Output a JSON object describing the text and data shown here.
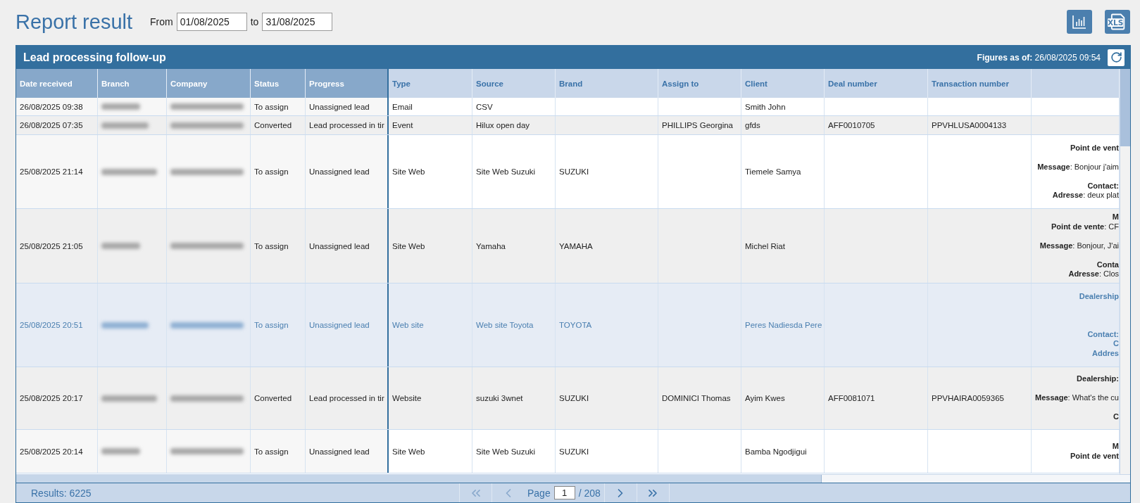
{
  "page_title": "Report result",
  "date_range": {
    "from_label": "From",
    "from_value": "01/08/2025",
    "to_label": "to",
    "to_value": "31/08/2025"
  },
  "toolbar_buttons": [
    {
      "kind": "chart"
    },
    {
      "kind": "xls",
      "label": "XLS"
    }
  ],
  "panel": {
    "title": "Lead processing follow-up",
    "figures_as_of": "**Figures as of:** 26/08/2025 09:54"
  },
  "table": {
    "columns": [
      {
        "label": "Date received",
        "frozen": true
      },
      {
        "label": "Branch",
        "frozen": true
      },
      {
        "label": "Company",
        "frozen": true
      },
      {
        "label": "Status",
        "frozen": true
      },
      {
        "label": "Progress",
        "frozen": true
      },
      {
        "label": "Type",
        "frozen": false
      },
      {
        "label": "Source",
        "frozen": false
      },
      {
        "label": "Brand",
        "frozen": false
      },
      {
        "label": "Assign to",
        "frozen": false
      },
      {
        "label": "Client",
        "frozen": false
      },
      {
        "label": "Deal number",
        "frozen": false
      },
      {
        "label": "Transaction number",
        "frozen": false
      },
      {
        "frozen": false
      }
    ],
    "rows": [
      {
        "selected": false,
        "cells": [
          {
            "kind": "text",
            "text": "26/08/2025 09:38"
          },
          {
            "kind": "blurred"
          },
          {
            "kind": "blurred"
          },
          {
            "kind": "text",
            "text": "To assign"
          },
          {
            "kind": "text",
            "text": "Unassigned lead"
          },
          {
            "kind": "text",
            "text": "Email"
          },
          {
            "kind": "text",
            "text": "CSV"
          },
          {
            "kind": "empty"
          },
          {
            "kind": "empty"
          },
          {
            "kind": "text",
            "text": "Smith John"
          },
          {
            "kind": "empty"
          },
          {
            "kind": "empty"
          },
          {
            "kind": "empty"
          }
        ]
      },
      {
        "selected": false,
        "cells": [
          {
            "kind": "text",
            "text": "26/08/2025 07:35"
          },
          {
            "kind": "blurred"
          },
          {
            "kind": "blurred"
          },
          {
            "kind": "text",
            "text": "Converted"
          },
          {
            "kind": "text",
            "text": "Lead processed in tir"
          },
          {
            "kind": "text",
            "text": "Event"
          },
          {
            "kind": "text",
            "text": "Hilux open day"
          },
          {
            "kind": "empty"
          },
          {
            "kind": "text",
            "text": "PHILLIPS Georgina"
          },
          {
            "kind": "text",
            "text": "gfds"
          },
          {
            "kind": "text",
            "text": "AFF0010705"
          },
          {
            "kind": "text",
            "text": "PPVHLUSA0004133"
          },
          {
            "kind": "empty"
          }
        ]
      },
      {
        "selected": false,
        "cells": [
          {
            "kind": "text",
            "text": "25/08/2025 21:14"
          },
          {
            "kind": "blurred"
          },
          {
            "kind": "blurred"
          },
          {
            "kind": "text",
            "text": "To assign"
          },
          {
            "kind": "text",
            "text": "Unassigned lead"
          },
          {
            "kind": "text",
            "text": "Site Web"
          },
          {
            "kind": "text",
            "text": "Site Web Suzuki"
          },
          {
            "kind": "text",
            "text": "SUZUKI"
          },
          {
            "kind": "empty"
          },
          {
            "kind": "text",
            "text": "Tiemele Samya"
          },
          {
            "kind": "empty"
          },
          {
            "kind": "empty"
          },
          {
            "kind": "notes",
            "lines": [
              {
                "kind": "line",
                "text": "Point de vent",
                "bold": true
              },
              {
                "kind": "blank"
              },
              {
                "kind": "line",
                "text": "**Message**: Bonjour j'aim",
                "bold": false
              },
              {
                "kind": "blank"
              },
              {
                "kind": "line",
                "text": "Contact:",
                "bold": true
              },
              {
                "kind": "line",
                "text": "**Adresse**: deux plat",
                "bold": false
              }
            ]
          }
        ]
      },
      {
        "selected": false,
        "cells": [
          {
            "kind": "text",
            "text": "25/08/2025 21:05"
          },
          {
            "kind": "blurred"
          },
          {
            "kind": "blurred"
          },
          {
            "kind": "text",
            "text": "To assign"
          },
          {
            "kind": "text",
            "text": "Unassigned lead"
          },
          {
            "kind": "text",
            "text": "Site Web"
          },
          {
            "kind": "text",
            "text": "Yamaha"
          },
          {
            "kind": "text",
            "text": "YAMAHA"
          },
          {
            "kind": "empty"
          },
          {
            "kind": "text",
            "text": "Michel Riat"
          },
          {
            "kind": "empty"
          },
          {
            "kind": "empty"
          },
          {
            "kind": "notes",
            "lines": [
              {
                "kind": "line",
                "text": "M",
                "bold": true
              },
              {
                "kind": "line",
                "text": "**Point de vente**: CF",
                "bold": false
              },
              {
                "kind": "blank"
              },
              {
                "kind": "line",
                "text": "**Message**: Bonjour, J'ai",
                "bold": false
              },
              {
                "kind": "blank"
              },
              {
                "kind": "line",
                "text": "Conta",
                "bold": true
              },
              {
                "kind": "line",
                "text": "**Adresse**: Clos",
                "bold": false
              }
            ]
          }
        ]
      },
      {
        "selected": true,
        "cells": [
          {
            "kind": "text",
            "text": "25/08/2025 20:51"
          },
          {
            "kind": "blurred"
          },
          {
            "kind": "blurred"
          },
          {
            "kind": "text",
            "text": "To assign"
          },
          {
            "kind": "text",
            "text": "Unassigned lead"
          },
          {
            "kind": "text",
            "text": "Web site"
          },
          {
            "kind": "text",
            "text": "Web site Toyota"
          },
          {
            "kind": "text",
            "text": "TOYOTA"
          },
          {
            "kind": "empty"
          },
          {
            "kind": "text",
            "text": "Peres Nadiesda Pere"
          },
          {
            "kind": "empty"
          },
          {
            "kind": "empty"
          },
          {
            "kind": "notes",
            "lines": [
              {
                "kind": "line",
                "text": "Dealership",
                "bold": true
              },
              {
                "kind": "blank"
              },
              {
                "kind": "blank"
              },
              {
                "kind": "blank"
              },
              {
                "kind": "line",
                "text": "Contact:",
                "bold": true
              },
              {
                "kind": "line",
                "text": "C",
                "bold": true
              },
              {
                "kind": "line",
                "text": "Addres",
                "bold": true
              }
            ]
          }
        ]
      },
      {
        "selected": false,
        "cells": [
          {
            "kind": "text",
            "text": "25/08/2025 20:17"
          },
          {
            "kind": "blurred"
          },
          {
            "kind": "blurred"
          },
          {
            "kind": "text",
            "text": "Converted"
          },
          {
            "kind": "text",
            "text": "Lead processed in tir"
          },
          {
            "kind": "text",
            "text": "Website"
          },
          {
            "kind": "text",
            "text": "suzuki 3wnet"
          },
          {
            "kind": "text",
            "text": "SUZUKI"
          },
          {
            "kind": "text",
            "text": "DOMINICI Thomas"
          },
          {
            "kind": "text",
            "text": "Ayim Kwes"
          },
          {
            "kind": "text",
            "text": "AFF0081071"
          },
          {
            "kind": "text",
            "text": "PPVHAIRA0059365"
          },
          {
            "kind": "notes",
            "lines": [
              {
                "kind": "line",
                "text": "Dealership:",
                "bold": true
              },
              {
                "kind": "blank"
              },
              {
                "kind": "line",
                "text": "**Message**: What's the cu",
                "bold": false
              },
              {
                "kind": "blank"
              },
              {
                "kind": "line",
                "text": "C",
                "bold": true
              }
            ]
          }
        ]
      },
      {
        "selected": false,
        "cells": [
          {
            "kind": "text",
            "text": "25/08/2025 20:14"
          },
          {
            "kind": "blurred"
          },
          {
            "kind": "blurred"
          },
          {
            "kind": "text",
            "text": "To assign"
          },
          {
            "kind": "text",
            "text": "Unassigned lead"
          },
          {
            "kind": "text",
            "text": "Site Web"
          },
          {
            "kind": "text",
            "text": "Site Web Suzuki"
          },
          {
            "kind": "text",
            "text": "SUZUKI"
          },
          {
            "kind": "empty"
          },
          {
            "kind": "text",
            "text": "Bamba Ngodjigui"
          },
          {
            "kind": "empty"
          },
          {
            "kind": "empty"
          },
          {
            "kind": "notes",
            "lines": [
              {
                "kind": "line",
                "text": "M",
                "bold": true
              },
              {
                "kind": "line",
                "text": "Point de vent",
                "bold": true
              }
            ]
          }
        ]
      }
    ]
  },
  "footer": {
    "results": "Results: 6225",
    "page_label": "Page",
    "page_value": "1",
    "page_total": "/ 208"
  }
}
